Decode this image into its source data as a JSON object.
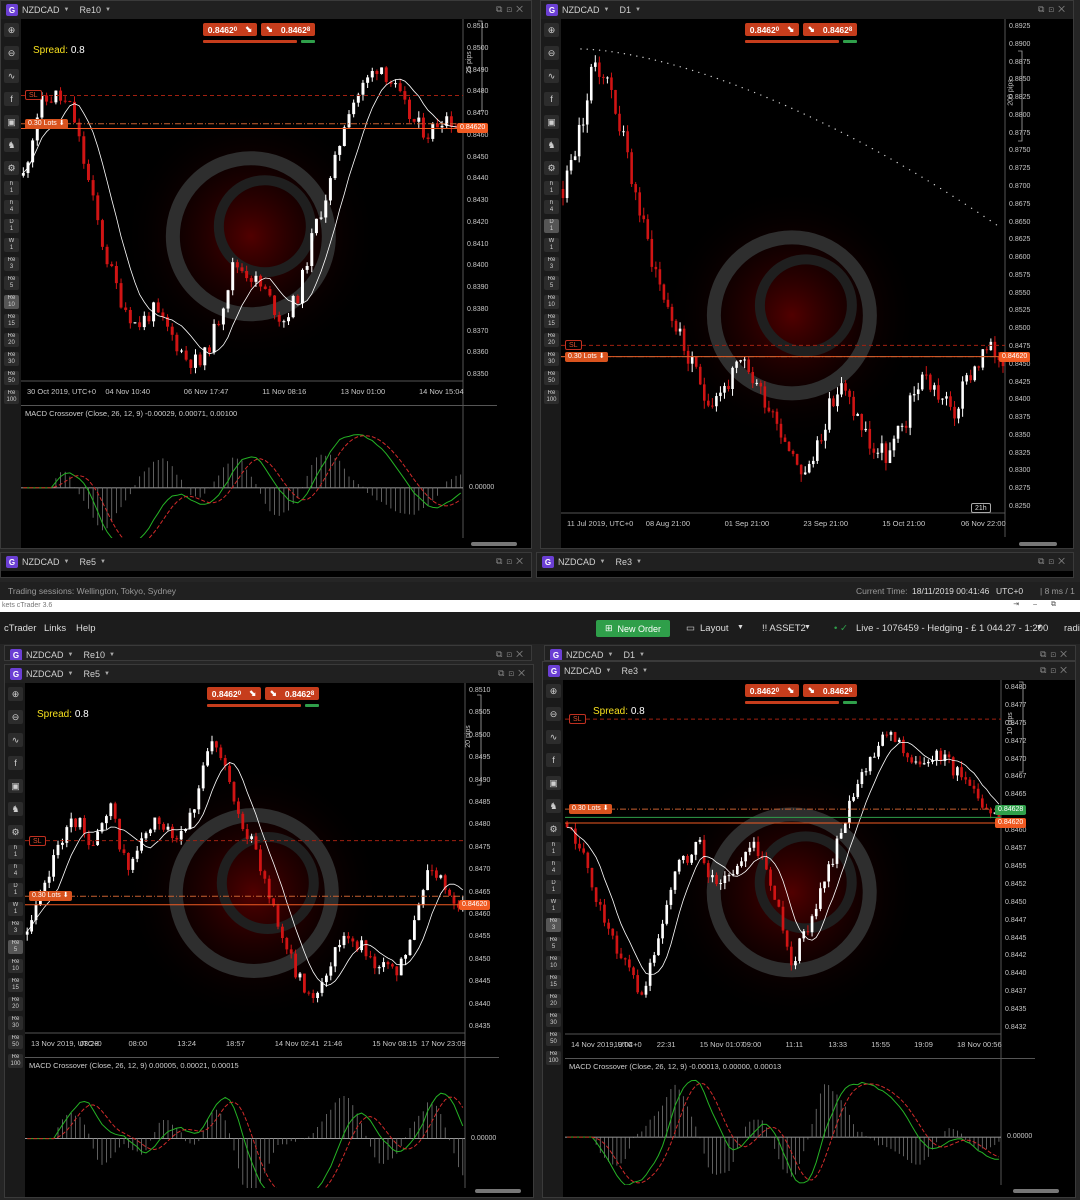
{
  "colors": {
    "accent_red": "#c63d1c",
    "accent_green": "#2f9f4a",
    "price_tag": "#f05a22",
    "bear": "#d01414",
    "bull": "#ffffff",
    "ma": "#ffffff",
    "macd_line": "#25b325",
    "signal_line": "#d02a2a"
  },
  "app": {
    "title": "kets cTrader 3.6",
    "menu": [
      "cTrader",
      "Links",
      "Help"
    ],
    "new_order": "New Order",
    "layout": "Layout",
    "asset": "!! ASSET2",
    "account": "Live  - 1076459 - Hedging - £ 1 044.27 - 1:200",
    "user": "radi"
  },
  "statusbar": {
    "sessions": "Trading sessions:  Wellington, Tokyo, Sydney",
    "time_label": "Current Time:",
    "time_value": "18/11/2019 00:41:46",
    "tz": "UTC+0",
    "latency": "| 8 ms / 1"
  },
  "windows": [
    {
      "id": "top-left",
      "symbol": "NZDCAD",
      "timeframe": "Re10",
      "spread_label": "Spread:",
      "spread_value": "0.8",
      "bid": "0.8462",
      "bid_sup": "0",
      "ask": "0.8462",
      "ask_sup": "8",
      "pips": "25 pips",
      "price_tag": "0.84620",
      "lots": "0.30 Lots",
      "sl": "SL",
      "y_labels": [
        "0.8510",
        "0.8500",
        "0.8490",
        "0.8480",
        "0.8470",
        "0.8460",
        "0.8450",
        "0.8440",
        "0.8430",
        "0.8420",
        "0.8410",
        "0.8400",
        "0.8390",
        "0.8380",
        "0.8370",
        "0.8360",
        "0.8350"
      ],
      "x_labels": [
        "30 Oct 2019, UTC+0",
        "04 Nov 10:40",
        "06 Nov 17:47",
        "11 Nov 08:16",
        "13 Nov 01:00",
        "14 Nov 15:04"
      ],
      "macd_label": "MACD Crossover (Close, 26, 12, 9) -0.00029, 0.00071, 0.00100",
      "macd_zero": "0.00000",
      "toolbar": [
        "h 1",
        "h 4",
        "D 1",
        "W 1",
        "Re 3",
        "Re 5",
        "Re 10",
        "Re 15",
        "Re 20",
        "Re 30",
        "Re 50",
        "Re 100"
      ],
      "active_tf": "Re 10"
    },
    {
      "id": "top-right",
      "symbol": "NZDCAD",
      "timeframe": "D1",
      "bid": "0.8462",
      "bid_sup": "0",
      "ask": "0.8462",
      "ask_sup": "8",
      "pips": "200 pips",
      "price_tag": "0.84620",
      "lots": "0.30 Lots",
      "sl": "SL",
      "bar_timer": "21h",
      "y_labels": [
        "0.8925",
        "0.8900",
        "0.8875",
        "0.8850",
        "0.8825",
        "0.8800",
        "0.8775",
        "0.8750",
        "0.8725",
        "0.8700",
        "0.8675",
        "0.8650",
        "0.8625",
        "0.8600",
        "0.8575",
        "0.8550",
        "0.8525",
        "0.8500",
        "0.8475",
        "0.8450",
        "0.8425",
        "0.8400",
        "0.8375",
        "0.8350",
        "0.8325",
        "0.8300",
        "0.8275",
        "0.8250"
      ],
      "x_labels": [
        "11 Jul 2019, UTC+0",
        "08 Aug 21:00",
        "01 Sep 21:00",
        "23 Sep 21:00",
        "15 Oct 21:00",
        "06 Nov 22:00"
      ],
      "toolbar": [
        "h 1",
        "h 4",
        "D 1",
        "W 1",
        "Re 3",
        "Re 5",
        "Re 10",
        "Re 15",
        "Re 20",
        "Re 30",
        "Re 50",
        "Re 100"
      ],
      "active_tf": "D 1"
    },
    {
      "id": "bottom-left",
      "symbol": "NZDCAD",
      "timeframe": "Re5",
      "behind_symbol": "NZDCAD",
      "behind_timeframe": "Re10",
      "spread_label": "Spread:",
      "spread_value": "0.8",
      "bid": "0.8462",
      "bid_sup": "0",
      "ask": "0.8462",
      "ask_sup": "8",
      "pips": "20 pips",
      "price_tag": "0.84620",
      "lots": "0.30 Lots",
      "sl": "SL",
      "y_labels": [
        "0.8510",
        "0.8505",
        "0.8500",
        "0.8495",
        "0.8490",
        "0.8485",
        "0.8480",
        "0.8475",
        "0.8470",
        "0.8465",
        "0.8460",
        "0.8455",
        "0.8450",
        "0.8445",
        "0.8440",
        "0.8435"
      ],
      "x_labels": [
        "13 Nov 2019, UTC+0",
        "03:23",
        "08:00",
        "13:24",
        "18:57",
        "14 Nov 02:41",
        "21:46",
        "15 Nov 08:15",
        "17 Nov 23:09"
      ],
      "macd_label": "MACD Crossover (Close, 26, 12, 9) 0.00005, 0.00021, 0.00015",
      "macd_zero": "0.00000",
      "toolbar": [
        "h 1",
        "h 4",
        "D 1",
        "W 1",
        "Re 3",
        "Re 5",
        "Re 10",
        "Re 15",
        "Re 20",
        "Re 30",
        "Re 50",
        "Re 100"
      ],
      "active_tf": "Re 5"
    },
    {
      "id": "bottom-right",
      "symbol": "NZDCAD",
      "timeframe": "Re3",
      "behind_symbol": "NZDCAD",
      "behind_timeframe": "D1",
      "spread_label": "Spread:",
      "spread_value": "0.8",
      "bid": "0.8462",
      "bid_sup": "0",
      "ask": "0.8462",
      "ask_sup": "8",
      "pips": "10 pips",
      "price_tag": "0.84620",
      "green_tag": "0.84628",
      "lots": "0.30 Lots",
      "sl": "SL",
      "y_labels": [
        "0.8480",
        "0.8477",
        "0.8475",
        "0.8472",
        "0.8470",
        "0.8467",
        "0.8465",
        "0.8462",
        "0.8460",
        "0.8457",
        "0.8455",
        "0.8452",
        "0.8450",
        "0.8447",
        "0.8445",
        "0.8442",
        "0.8440",
        "0.8437",
        "0.8435",
        "0.8432"
      ],
      "x_labels": [
        "14 Nov 2019, UTC+0",
        "19:04",
        "22:31",
        "15 Nov 01:07",
        "09:00",
        "11:11",
        "13:33",
        "15:55",
        "19:09",
        "18 Nov 00:56"
      ],
      "macd_label": "MACD Crossover (Close, 26, 12, 9) -0.00013, 0.00000, 0.00013",
      "macd_zero": "0.00000",
      "toolbar": [
        "h 1",
        "h 4",
        "D 1",
        "W 1",
        "Re 3",
        "Re 5",
        "Re 10",
        "Re 15",
        "Re 20",
        "Re 30",
        "Re 50",
        "Re 100"
      ],
      "active_tf": "Re 3"
    }
  ],
  "collapsed_windows": [
    {
      "symbol": "NZDCAD",
      "timeframe": "Re5"
    },
    {
      "symbol": "NZDCAD",
      "timeframe": "Re3"
    }
  ]
}
